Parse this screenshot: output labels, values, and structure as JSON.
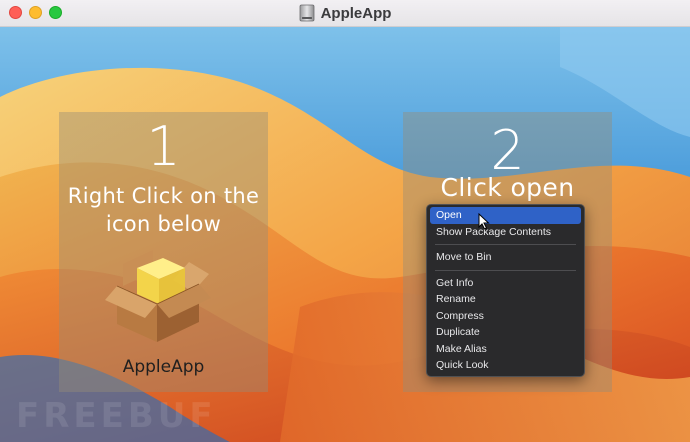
{
  "window": {
    "title": "AppleApp",
    "icons": {
      "title": "disk-icon",
      "close": "close-icon",
      "minimize": "minimize-icon",
      "zoom": "zoom-icon"
    }
  },
  "colors": {
    "close": "#ff5f57",
    "minimize": "#febc2e",
    "zoom": "#28c840",
    "menu_highlight": "#2f62c7"
  },
  "steps": [
    {
      "number": "1",
      "instruction": [
        "Right Click on the",
        "icon below"
      ],
      "app_label": "AppleApp",
      "icon": "package-box-icon"
    },
    {
      "number": "2",
      "instruction": [
        "Click open"
      ]
    }
  ],
  "context_menu": {
    "groups": [
      [
        "Open",
        "Show Package Contents"
      ],
      [
        "Move to Bin"
      ],
      [
        "Get Info",
        "Rename",
        "Compress",
        "Duplicate",
        "Make Alias",
        "Quick Look"
      ]
    ],
    "selected": "Open"
  },
  "watermark": "FREEBUF"
}
